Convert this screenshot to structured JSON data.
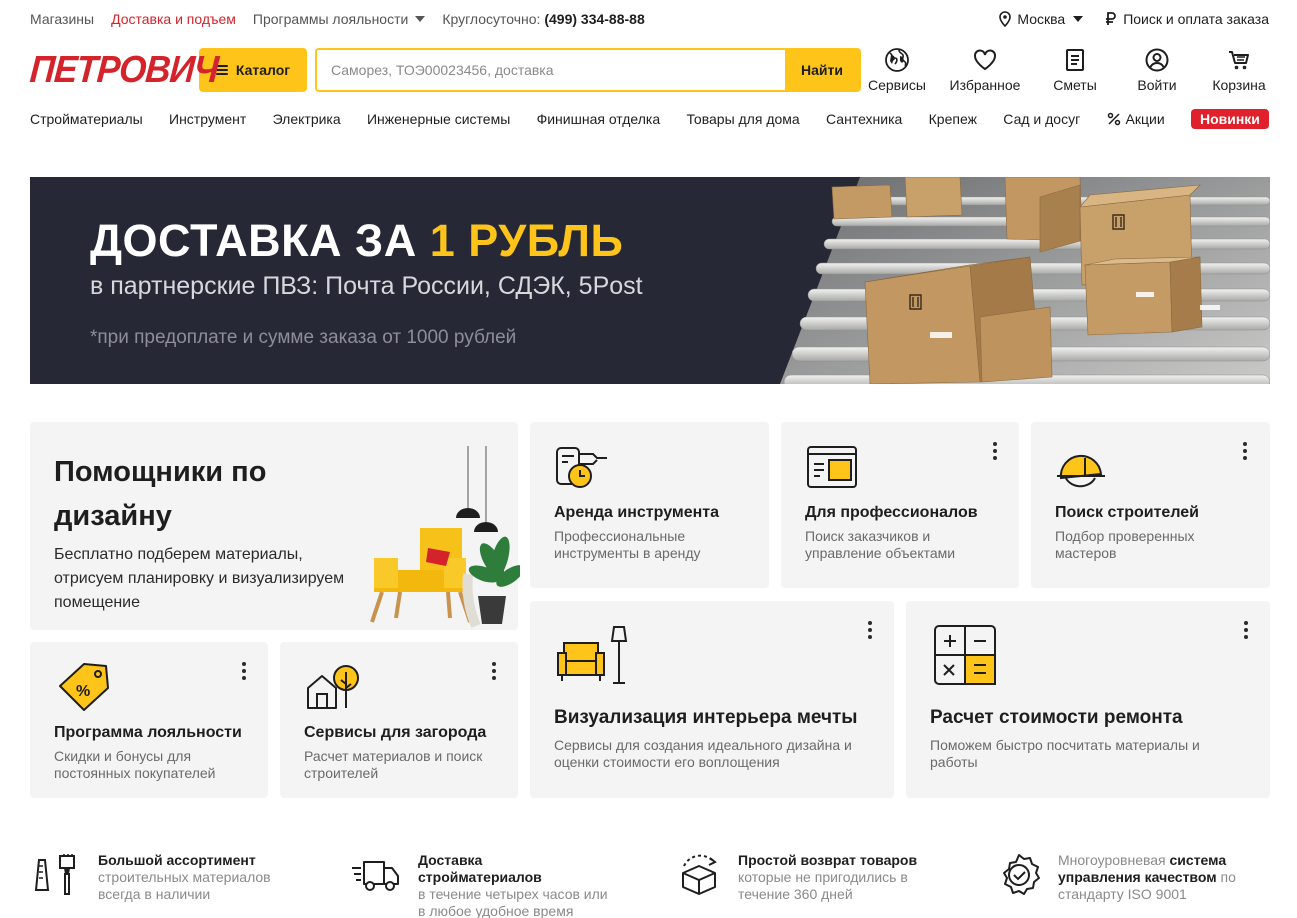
{
  "topbar": {
    "stores": "Магазины",
    "delivery": "Доставка и подъем",
    "loyalty": "Программы лояльности",
    "phone_label": "Круглосуточно:",
    "phone": "(499) 334-88-88",
    "city": "Москва",
    "order_search": "Поиск и оплата заказа"
  },
  "header": {
    "logo": "ПЕТРОВИЧ",
    "catalog": "Каталог",
    "search_placeholder": "Саморез, ТОЭ00023456, доставка",
    "search_button": "Найти",
    "icons": [
      {
        "label": "Сервисы",
        "icon": "globe-icon"
      },
      {
        "label": "Избранное",
        "icon": "heart-icon"
      },
      {
        "label": "Сметы",
        "icon": "document-icon"
      },
      {
        "label": "Войти",
        "icon": "user-icon"
      },
      {
        "label": "Корзина",
        "icon": "cart-icon"
      }
    ]
  },
  "nav": {
    "items": [
      "Стройматериалы",
      "Инструмент",
      "Электрика",
      "Инженерные системы",
      "Финишная отделка",
      "Товары для дома",
      "Сантехника",
      "Крепеж",
      "Сад и досуг"
    ],
    "promo": "Акции",
    "new": "Новинки"
  },
  "banner": {
    "title_prefix": "ДОСТАВКА ЗА ",
    "title_accent": "1 РУБЛЬ",
    "subtitle": "в партнерские ПВЗ: Почта России, СДЭК, 5Post",
    "note": "*при предоплате и сумме заказа от 1000 рублей"
  },
  "cards": {
    "design": {
      "title": "Помощники по дизайну",
      "desc": "Бесплатно подберем материалы, отрисуем планировку и визуализируем помещение"
    },
    "rent": {
      "title": "Аренда инструмента",
      "desc": "Профессиональные инструменты в аренду"
    },
    "pro": {
      "title": "Для профессионалов",
      "desc": "Поиск заказчиков и управление объектами"
    },
    "builders": {
      "title": "Поиск строителей",
      "desc": "Подбор проверенных мастеров"
    },
    "loyalty": {
      "title": "Программа лояльности",
      "desc": "Скидки и бонусы для постоянных покупателей"
    },
    "country": {
      "title": "Сервисы для загорода",
      "desc": "Расчет материалов и поиск строителей"
    },
    "interior": {
      "title": "Визуализация интерьера мечты",
      "desc": "Сервисы для создания идеального дизайна и оценки стоимости его воплощения"
    },
    "repair": {
      "title": "Расчет стоимости ремонта",
      "desc": "Поможем быстро посчитать материалы и работы"
    }
  },
  "features": {
    "assortment": {
      "bold": "Большой ассортимент",
      "gray": "строительных материалов всегда в наличии"
    },
    "delivery": {
      "bold": "Доставка стройматериалов",
      "gray": "в течение четырех часов или в любое удобное время"
    },
    "returns": {
      "bold": "Простой возврат товаров",
      "gray": "которые не пригодились в течение 360 дней"
    },
    "quality": {
      "gray1": "Многоуровневая ",
      "bold": "система управления качеством",
      "gray2": " по стандарту ISO 9001"
    }
  },
  "colors": {
    "brand_red": "#d4232b",
    "accent_yellow": "#ffc419",
    "banner_bg": "#262836",
    "card_bg": "#f4f4f5"
  }
}
